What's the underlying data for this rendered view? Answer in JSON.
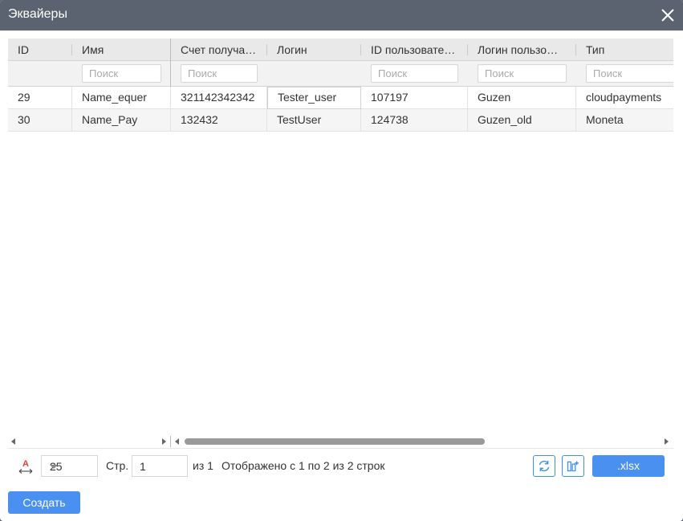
{
  "window": {
    "title": "Эквайеры"
  },
  "grid": {
    "columns": [
      {
        "key": "id",
        "label": "ID",
        "filter": false
      },
      {
        "key": "name",
        "label": "Имя",
        "filter": true
      },
      {
        "key": "account",
        "label": "Счет получа…",
        "filter": true
      },
      {
        "key": "login",
        "label": "Логин",
        "filter": false
      },
      {
        "key": "user_id",
        "label": "ID пользовате…",
        "filter": true
      },
      {
        "key": "user_login",
        "label": "Логин пользо…",
        "filter": true
      },
      {
        "key": "type",
        "label": "Тип",
        "filter": true
      }
    ],
    "filter_placeholder": "Поиск",
    "rows": [
      {
        "id": "29",
        "name": "Name_equer",
        "account": "321142342342",
        "login": "Tester_user",
        "user_id": "107197",
        "user_login": "Guzen",
        "type": "cloudpayments"
      },
      {
        "id": "30",
        "name": "Name_Pay",
        "account": "132432",
        "login": "TestUser",
        "user_id": "124738",
        "user_login": "Guzen_old",
        "type": "Moneta"
      }
    ]
  },
  "pager": {
    "page_size": "25",
    "page_label": "Стр.",
    "page_value": "1",
    "of_label": "из 1",
    "summary": "Отображено с 1 по 2 из 2 строк",
    "export_label": ".xlsx"
  },
  "actions": {
    "create_label": "Создать"
  },
  "colors": {
    "titlebar": "#5b6270",
    "accent": "#4a90f0",
    "font_icon": "#e53935"
  }
}
